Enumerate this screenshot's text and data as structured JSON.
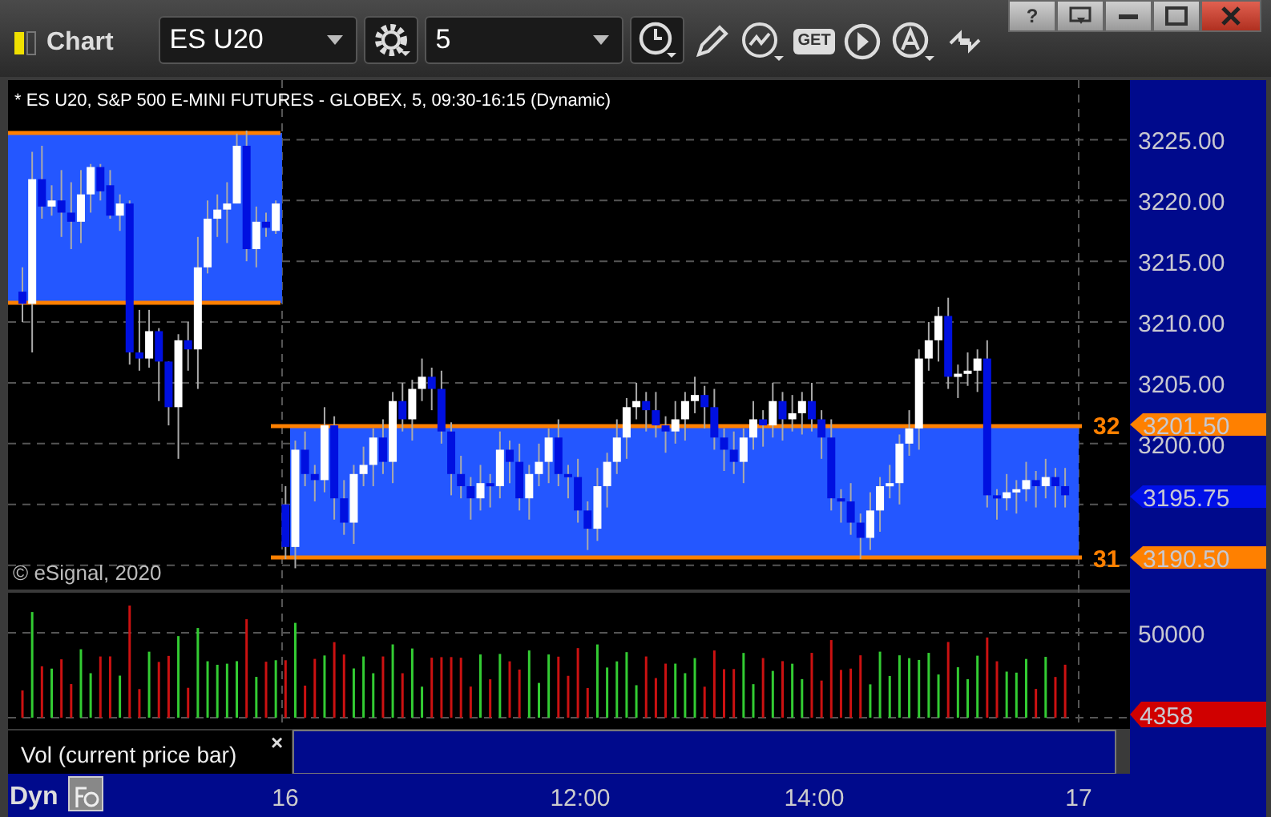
{
  "window": {
    "title": "Chart",
    "help": "?"
  },
  "toolbar": {
    "symbol": "ES U20",
    "interval": "5",
    "get_label": "GET"
  },
  "chart": {
    "header": "* ES U20, S&P 500 E-MINI FUTURES - GLOBEX, 5, 09:30-16:15 (Dynamic)",
    "copyright": "© eSignal, 2020",
    "chart_data": {
      "type": "candlestick",
      "ylim": [
        3188,
        3229.9
      ],
      "yticks": [
        {
          "value": 3225,
          "label": "3225.00"
        },
        {
          "value": 3220,
          "label": "3220.00"
        },
        {
          "value": 3215,
          "label": "3215.00"
        },
        {
          "value": 3210,
          "label": "3210.00"
        },
        {
          "value": 3205,
          "label": "3205.00"
        },
        {
          "value": 3200,
          "label": "3200.00"
        }
      ],
      "categories": [
        null,
        null,
        null,
        null,
        null,
        null,
        null,
        null,
        null,
        null,
        null,
        null,
        null,
        null,
        null,
        null,
        null,
        null,
        null,
        null,
        null,
        null,
        null,
        null,
        null,
        null,
        null,
        null,
        null,
        null,
        null,
        null,
        null,
        null,
        null,
        null,
        null,
        null,
        null,
        null,
        null,
        null,
        null,
        null,
        null,
        null,
        null,
        null,
        null,
        null,
        null,
        null,
        null,
        null,
        null,
        null,
        null,
        null,
        null,
        null,
        null,
        null,
        null,
        null,
        null,
        null,
        null,
        null,
        null,
        null,
        null,
        null,
        null,
        null,
        null,
        null,
        null,
        null,
        null,
        null,
        null,
        null,
        null,
        null,
        null,
        null,
        null,
        null,
        null,
        null,
        null,
        null,
        null,
        null,
        null,
        null,
        null,
        null,
        null,
        null,
        null,
        null,
        null,
        null,
        null,
        null,
        null,
        null
      ],
      "ohlc": [
        [
          3212.5,
          3214.5,
          3210,
          3211.5
        ],
        [
          3211.5,
          3224,
          3207.5,
          3221.75
        ],
        [
          3221.75,
          3224.5,
          3218.5,
          3219.5
        ],
        [
          3219.5,
          3221.25,
          3218.75,
          3220
        ],
        [
          3220,
          3222.5,
          3217,
          3219
        ],
        [
          3219,
          3221.5,
          3216,
          3218.25
        ],
        [
          3218.25,
          3222.5,
          3216.5,
          3220.5
        ],
        [
          3220.5,
          3223,
          3219,
          3222.75
        ],
        [
          3222.75,
          3223,
          3220,
          3220.75
        ],
        [
          3221.25,
          3222.5,
          3218.5,
          3218.75
        ],
        [
          3218.75,
          3220.5,
          3217.5,
          3219.75
        ],
        [
          3219.75,
          3220,
          3206.5,
          3207.5
        ],
        [
          3207.5,
          3211,
          3206,
          3207
        ],
        [
          3207,
          3211,
          3206.25,
          3209.25
        ],
        [
          3209.25,
          3209.5,
          3203.5,
          3206.75
        ],
        [
          3206.75,
          3206.75,
          3201.5,
          3203
        ],
        [
          3203,
          3209,
          3198.75,
          3208.5
        ],
        [
          3208.5,
          3210,
          3206,
          3207.75
        ],
        [
          3207.75,
          3217,
          3204.5,
          3214.5
        ],
        [
          3214.5,
          3220,
          3214,
          3218.5
        ],
        [
          3218.5,
          3220.5,
          3217,
          3219.25
        ],
        [
          3219.25,
          3221.5,
          3216.5,
          3219.75
        ],
        [
          3219.75,
          3225.5,
          3219.75,
          3224.5
        ],
        [
          3224.5,
          3225.75,
          3215,
          3216
        ],
        [
          3216,
          3219.5,
          3214.5,
          3218.25
        ],
        [
          3218.25,
          3219,
          3217,
          3217.75
        ],
        [
          3217.5,
          3220,
          3217.25,
          3219.75
        ],
        [
          3195,
          3196.5,
          3190.5,
          3191.5
        ],
        [
          3191.5,
          3200.25,
          3189.75,
          3199.5
        ],
        [
          3199.5,
          3201,
          3196.5,
          3197.5
        ],
        [
          3197.5,
          3198.25,
          3195.25,
          3197
        ],
        [
          3197,
          3203,
          3196,
          3201.5
        ],
        [
          3201.5,
          3202.25,
          3193.75,
          3195.5
        ],
        [
          3195.5,
          3197,
          3192.5,
          3193.5
        ],
        [
          3193.5,
          3198.25,
          3191.75,
          3197.5
        ],
        [
          3197.5,
          3199.75,
          3196.5,
          3198.25
        ],
        [
          3198.25,
          3201.25,
          3196.5,
          3200.5
        ],
        [
          3200.5,
          3202,
          3197.5,
          3198.5
        ],
        [
          3198.5,
          3204.25,
          3196.75,
          3203.5
        ],
        [
          3203.5,
          3205,
          3201,
          3202
        ],
        [
          3202,
          3205.25,
          3200.25,
          3204.5
        ],
        [
          3204.5,
          3207,
          3203.5,
          3205.5
        ],
        [
          3205.5,
          3206.25,
          3202.75,
          3204.5
        ],
        [
          3204.5,
          3206,
          3200,
          3201
        ],
        [
          3201,
          3201.75,
          3195.75,
          3197.5
        ],
        [
          3197.5,
          3199,
          3195.5,
          3196.5
        ],
        [
          3196.5,
          3197.25,
          3193.75,
          3195.5
        ],
        [
          3195.5,
          3198.25,
          3194.5,
          3196.75
        ],
        [
          3196.75,
          3197.5,
          3194.75,
          3196.5
        ],
        [
          3196.5,
          3201,
          3195.5,
          3199.5
        ],
        [
          3199.5,
          3200.25,
          3196.75,
          3198.5
        ],
        [
          3198.5,
          3200,
          3194.5,
          3195.5
        ],
        [
          3195.5,
          3198.25,
          3193.75,
          3197.5
        ],
        [
          3197.5,
          3200,
          3196.5,
          3198.5
        ],
        [
          3198.5,
          3201.25,
          3196.75,
          3200.5
        ],
        [
          3200.5,
          3202,
          3196.5,
          3197.5
        ],
        [
          3197.5,
          3198.25,
          3195.5,
          3197.25
        ],
        [
          3197.25,
          3198.75,
          3193.5,
          3194.5
        ],
        [
          3194.5,
          3195.25,
          3191.25,
          3193
        ],
        [
          3193,
          3198,
          3192,
          3196.5
        ],
        [
          3196.5,
          3199.25,
          3194.75,
          3198.5
        ],
        [
          3198.5,
          3202,
          3197.5,
          3200.5
        ],
        [
          3200.5,
          3203.75,
          3198.75,
          3203
        ],
        [
          3203,
          3205,
          3202,
          3203.5
        ],
        [
          3203.5,
          3204.25,
          3201,
          3202.75
        ],
        [
          3202.75,
          3204.25,
          3200.5,
          3201.5
        ],
        [
          3201.5,
          3202.25,
          3199.25,
          3201
        ],
        [
          3201,
          3203.5,
          3200,
          3202
        ],
        [
          3202,
          3204.25,
          3200.25,
          3203.5
        ],
        [
          3203.5,
          3205.5,
          3202.5,
          3204
        ],
        [
          3204,
          3204.75,
          3201.25,
          3203
        ],
        [
          3203,
          3204.5,
          3199.5,
          3200.5
        ],
        [
          3200.5,
          3201.25,
          3197.75,
          3199.5
        ],
        [
          3199.5,
          3201,
          3197.5,
          3198.5
        ],
        [
          3198.5,
          3201.25,
          3196.75,
          3200.5
        ],
        [
          3200.5,
          3203.5,
          3199.5,
          3202
        ],
        [
          3202,
          3202.75,
          3199.75,
          3201.5
        ],
        [
          3201.5,
          3205,
          3200.5,
          3203.5
        ],
        [
          3203.5,
          3204.25,
          3200.25,
          3202
        ],
        [
          3202,
          3204,
          3201,
          3202.5
        ],
        [
          3202.5,
          3204.25,
          3200.75,
          3203.5
        ],
        [
          3203.5,
          3205,
          3201,
          3202
        ],
        [
          3202,
          3202.75,
          3198.75,
          3200.5
        ],
        [
          3200.5,
          3202,
          3194.5,
          3195.5
        ],
        [
          3195.5,
          3196.25,
          3193.5,
          3195.25
        ],
        [
          3195.25,
          3196.75,
          3192.5,
          3193.5
        ],
        [
          3193.5,
          3194.25,
          3190.5,
          3192.25
        ],
        [
          3192.25,
          3196,
          3191.25,
          3194.5
        ],
        [
          3194.5,
          3197.25,
          3192.75,
          3196.5
        ],
        [
          3196.5,
          3198.25,
          3195.5,
          3196.75
        ],
        [
          3196.75,
          3200.75,
          3195,
          3200
        ],
        [
          3200,
          3202.75,
          3199,
          3201.25
        ],
        [
          3201.25,
          3207.75,
          3199.5,
          3207
        ],
        [
          3207,
          3210,
          3206,
          3208.5
        ],
        [
          3208.5,
          3211.25,
          3206.75,
          3210.5
        ],
        [
          3210.5,
          3212,
          3204.5,
          3205.5
        ],
        [
          3205.5,
          3206.5,
          3203.75,
          3205.75
        ],
        [
          3205.75,
          3207.5,
          3204.75,
          3206
        ],
        [
          3206,
          3207.75,
          3204.25,
          3207
        ],
        [
          3207,
          3208.5,
          3194.75,
          3195.75
        ],
        [
          3195.75,
          3196.25,
          3193.75,
          3195.5
        ],
        [
          3195.5,
          3197.5,
          3194.5,
          3196
        ],
        [
          3196,
          3197,
          3194.25,
          3196.25
        ],
        [
          3196.25,
          3198.5,
          3195.25,
          3197
        ],
        [
          3197,
          3197.75,
          3194.75,
          3196.5
        ],
        [
          3196.5,
          3198.75,
          3195.5,
          3197.25
        ],
        [
          3197.25,
          3198,
          3194.75,
          3196.5
        ],
        [
          3196.5,
          3198,
          3194.75,
          3195.75
        ]
      ]
    },
    "markers": [
      {
        "label": "3201.50",
        "tag": "32",
        "color": "#ff8000"
      },
      {
        "label": "3195.75",
        "color": "#0010e8"
      },
      {
        "label": "3190.50",
        "tag": "31",
        "color": "#ff8000"
      }
    ]
  },
  "volume": {
    "axis_label": "50000",
    "marker": {
      "label": "4358",
      "color": "#d00000"
    },
    "legend": "Vol (current price bar)",
    "close": "×"
  },
  "time_axis": {
    "mode": "Dyn",
    "labels": [
      "16",
      "12:00",
      "14:00",
      "17"
    ]
  }
}
